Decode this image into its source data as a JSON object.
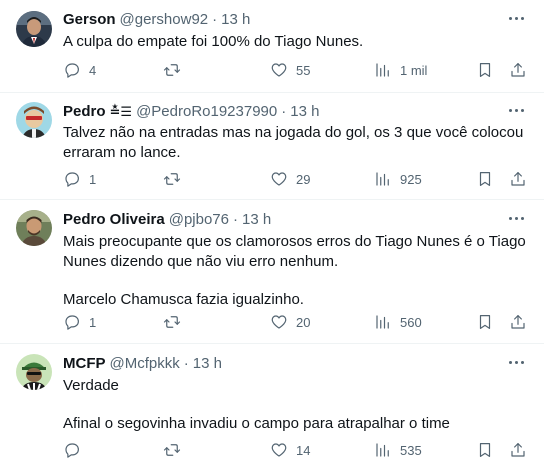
{
  "tweets": [
    {
      "name": "Gerson",
      "badge": "",
      "handle": "@gershow92",
      "time": "13 h",
      "lines": [
        "A culpa do empate foi 100% do Tiago Nunes."
      ],
      "replies": "4",
      "retweets": "",
      "likes": "55",
      "views": "1 mil"
    },
    {
      "name": "Pedro",
      "badge": "≛☰",
      "handle": "@PedroRo19237990",
      "time": "13 h",
      "lines": [
        "Talvez não na entradas mas na jogada do gol, os 3 que você colocou",
        "erraram no lance."
      ],
      "replies": "1",
      "retweets": "",
      "likes": "29",
      "views": "925"
    },
    {
      "name": "Pedro Oliveira",
      "badge": "",
      "handle": "@pjbo76",
      "time": "13 h",
      "lines": [
        "Mais preocupante que os clamorosos erros do Tiago Nunes é o Tiago",
        "Nunes dizendo que não viu erro nenhum."
      ],
      "extra": "Marcelo Chamusca fazia igualzinho.",
      "replies": "1",
      "retweets": "",
      "likes": "20",
      "views": "560"
    },
    {
      "name": "MCFP",
      "badge": "",
      "handle": "@Mcfpkkk",
      "time": "13 h",
      "lines": [
        "Verdade"
      ],
      "extra": "Afinal o segovinha invadiu o campo para atrapalhar o time",
      "replies": "",
      "retweets": "",
      "likes": "14",
      "views": "535"
    }
  ],
  "separator": "·",
  "icons": [
    "more-icon",
    "reply-icon",
    "retweet-icon",
    "like-icon",
    "views-icon",
    "bookmark-icon",
    "share-icon"
  ],
  "colors": {
    "text": "#0f1419",
    "secondary": "#536471",
    "divider": "#eff3f4"
  }
}
